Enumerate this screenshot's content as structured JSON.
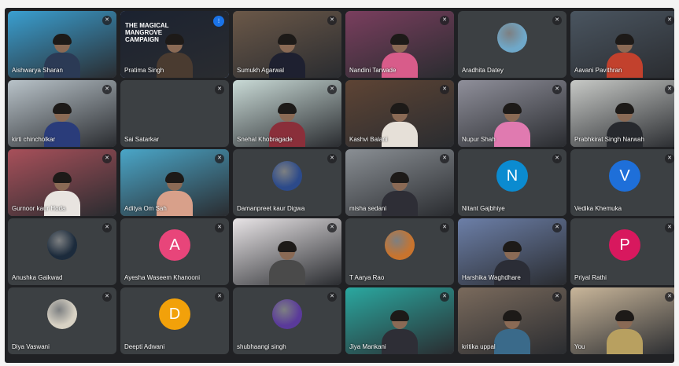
{
  "meeting": {
    "participants": [
      {
        "name": "Aishwarya Sharan",
        "type": "video",
        "wall": "#3a9fd0",
        "shirt": "#2b3a55"
      },
      {
        "name": "Pratima Singh",
        "type": "video",
        "wall": "#1b2230",
        "shirt": "#4a3b30",
        "active": true,
        "banner": "THE MAGICAL MANGROVE CAMPAIGN",
        "badge": "⁝"
      },
      {
        "name": "Sumukh Agarwal",
        "type": "video",
        "wall": "#6b5848",
        "shirt": "#1e2030"
      },
      {
        "name": "Nandini Tarwade",
        "type": "video",
        "wall": "#7a3e5e",
        "shirt": "#d85c8a"
      },
      {
        "name": "Aradhita Datey",
        "type": "photo",
        "color": "#6fa8c9"
      },
      {
        "name": "Aavani Pavithran",
        "type": "video",
        "wall": "#4a5560",
        "shirt": "#c2412d"
      },
      {
        "name": "kirti chincholkar",
        "type": "video",
        "wall": "#b9c3c9",
        "shirt": "#2a3c7a"
      },
      {
        "name": "Sai Satarkar",
        "type": "blank"
      },
      {
        "name": "Snehal Khobragade",
        "type": "video",
        "wall": "#c9dad6",
        "shirt": "#8a2f3a"
      },
      {
        "name": "Kashvi Balani",
        "type": "video",
        "wall": "#5e4434",
        "shirt": "#e6e0d8"
      },
      {
        "name": "Nupur Shah",
        "type": "video",
        "wall": "#8f8f9a",
        "shirt": "#e07ab0"
      },
      {
        "name": "Prabhkirat Singh Narwah",
        "type": "video",
        "wall": "#c7c9c6",
        "shirt": "#27292e"
      },
      {
        "name": "Gurnoor kaur Hoda",
        "type": "video",
        "wall": "#a8505a",
        "shirt": "#e8e4e0"
      },
      {
        "name": "Aditya Om Sah",
        "type": "video",
        "wall": "#4aa6c8",
        "shirt": "#d8a08a"
      },
      {
        "name": "Damanpreet kaur Digwa",
        "type": "photo",
        "color": "#2c4a8a"
      },
      {
        "name": "misha sedani",
        "type": "video",
        "wall": "#8a8f94",
        "shirt": "#2e2e36"
      },
      {
        "name": "Nitant Gajbhiye",
        "type": "avatar",
        "letter": "N",
        "color": "#0b8bd0"
      },
      {
        "name": "Vedika Khemuka",
        "type": "avatar",
        "letter": "V",
        "color": "#1e6fd9"
      },
      {
        "name": "Anushka Gaikwad",
        "type": "photo",
        "color": "#1c2b3c"
      },
      {
        "name": "Ayesha Waseem Khanooni",
        "type": "avatar",
        "letter": "A",
        "color": "#e8457a"
      },
      {
        "name": "",
        "type": "video",
        "wall": "#e8e4e6",
        "shirt": "#4a4a4a"
      },
      {
        "name": "T Aarya Rao",
        "type": "photo",
        "color": "#c8742e"
      },
      {
        "name": "Harshika Waghdhare",
        "type": "video",
        "wall": "#6c7fa8",
        "shirt": "#2b2d36"
      },
      {
        "name": "Priyal Rathi",
        "type": "avatar",
        "letter": "P",
        "color": "#d8185e"
      },
      {
        "name": "Diya Vaswani",
        "type": "photo",
        "color": "#d8d2c4"
      },
      {
        "name": "Deepti Adwani",
        "type": "avatar",
        "letter": "D",
        "color": "#f2a10a"
      },
      {
        "name": "shubhaangi singh",
        "type": "photo",
        "color": "#5a3a9a"
      },
      {
        "name": "Jiya Mankani",
        "type": "video",
        "wall": "#2aa8a0",
        "shirt": "#2e2e36"
      },
      {
        "name": "kritika uppal",
        "type": "video",
        "wall": "#7a6a5c",
        "shirt": "#3a6a8a"
      },
      {
        "name": "You",
        "type": "video",
        "wall": "#c9b69a",
        "shirt": "#b8a060"
      }
    ],
    "mic_icon": "muted-mic-icon"
  }
}
